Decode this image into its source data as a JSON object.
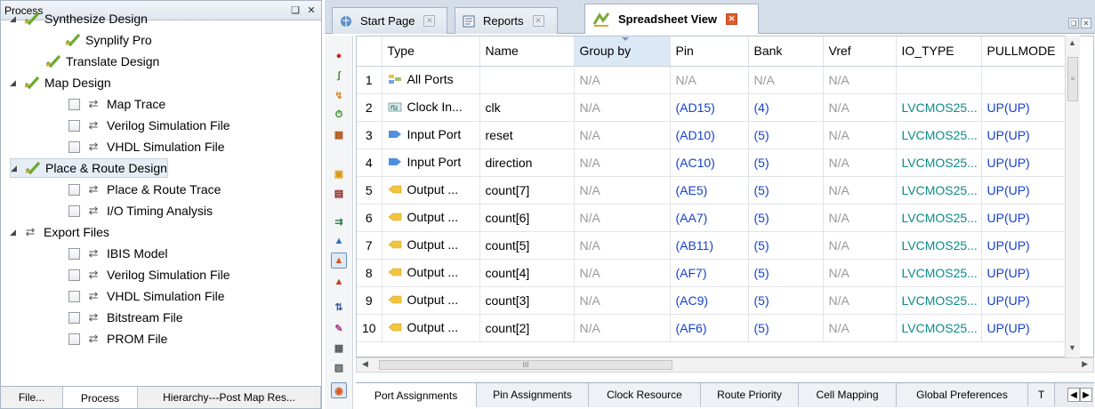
{
  "left_panel": {
    "title": "Process",
    "tree": [
      {
        "label": "Synthesize Design",
        "kind": "expanded-ok"
      },
      {
        "label": "Synplify Pro",
        "kind": "ok-child"
      },
      {
        "label": "Translate Design",
        "kind": "ok"
      },
      {
        "label": "Map Design",
        "kind": "expanded-ok"
      },
      {
        "label": "Map Trace",
        "kind": "check"
      },
      {
        "label": "Verilog Simulation File",
        "kind": "check"
      },
      {
        "label": "VHDL Simulation File",
        "kind": "check"
      },
      {
        "label": "Place & Route Design",
        "kind": "expanded-ok-selected"
      },
      {
        "label": "Place & Route Trace",
        "kind": "check"
      },
      {
        "label": "I/O Timing Analysis",
        "kind": "check"
      },
      {
        "label": "Export Files",
        "kind": "expanded-cycle"
      },
      {
        "label": "IBIS Model",
        "kind": "check"
      },
      {
        "label": "Verilog Simulation File",
        "kind": "check"
      },
      {
        "label": "VHDL Simulation File",
        "kind": "check"
      },
      {
        "label": "Bitstream File",
        "kind": "check"
      },
      {
        "label": "PROM File",
        "kind": "check"
      }
    ],
    "tabs": [
      "File...",
      "Process",
      "Hierarchy---Post Map Res..."
    ],
    "active_tab": "Process"
  },
  "doc_tabs": [
    {
      "label": "Start Page"
    },
    {
      "label": "Reports"
    },
    {
      "label": "Spreadsheet View",
      "active": true
    }
  ],
  "grid": {
    "columns": [
      "Type",
      "Name",
      "Group by",
      "Pin",
      "Bank",
      "Vref",
      "IO_TYPE",
      "PULLMODE"
    ],
    "rows": [
      {
        "n": "1",
        "type": "All Ports",
        "icon": "all",
        "name": "",
        "group": "N/A",
        "pin": "N/A",
        "bank": "N/A",
        "vref": "N/A",
        "io": "",
        "pull": ""
      },
      {
        "n": "2",
        "type": "Clock In...",
        "icon": "clock",
        "name": "clk",
        "group": "N/A",
        "pin": "(AD15)",
        "bank": "(4)",
        "vref": "N/A",
        "io": "LVCMOS25...",
        "pull": "UP(UP)"
      },
      {
        "n": "3",
        "type": "Input Port",
        "icon": "in",
        "name": "reset",
        "group": "N/A",
        "pin": "(AD10)",
        "bank": "(5)",
        "vref": "N/A",
        "io": "LVCMOS25...",
        "pull": "UP(UP)"
      },
      {
        "n": "4",
        "type": "Input Port",
        "icon": "in",
        "name": "direction",
        "group": "N/A",
        "pin": "(AC10)",
        "bank": "(5)",
        "vref": "N/A",
        "io": "LVCMOS25...",
        "pull": "UP(UP)"
      },
      {
        "n": "5",
        "type": "Output ...",
        "icon": "out",
        "name": "count[7]",
        "group": "N/A",
        "pin": "(AE5)",
        "bank": "(5)",
        "vref": "N/A",
        "io": "LVCMOS25...",
        "pull": "UP(UP)"
      },
      {
        "n": "6",
        "type": "Output ...",
        "icon": "out",
        "name": "count[6]",
        "group": "N/A",
        "pin": "(AA7)",
        "bank": "(5)",
        "vref": "N/A",
        "io": "LVCMOS25...",
        "pull": "UP(UP)"
      },
      {
        "n": "7",
        "type": "Output ...",
        "icon": "out",
        "name": "count[5]",
        "group": "N/A",
        "pin": "(AB11)",
        "bank": "(5)",
        "vref": "N/A",
        "io": "LVCMOS25...",
        "pull": "UP(UP)"
      },
      {
        "n": "8",
        "type": "Output ...",
        "icon": "out",
        "name": "count[4]",
        "group": "N/A",
        "pin": "(AF7)",
        "bank": "(5)",
        "vref": "N/A",
        "io": "LVCMOS25...",
        "pull": "UP(UP)"
      },
      {
        "n": "9",
        "type": "Output ...",
        "icon": "out",
        "name": "count[3]",
        "group": "N/A",
        "pin": "(AC9)",
        "bank": "(5)",
        "vref": "N/A",
        "io": "LVCMOS25...",
        "pull": "UP(UP)"
      },
      {
        "n": "10",
        "type": "Output ...",
        "icon": "out",
        "name": "count[2]",
        "group": "N/A",
        "pin": "(AF6)",
        "bank": "(5)",
        "vref": "N/A",
        "io": "LVCMOS25...",
        "pull": "UP(UP)"
      }
    ]
  },
  "hscroll_thumb": "III",
  "bottom_tabs": [
    "Port Assignments",
    "Pin Assignments",
    "Clock Resource",
    "Route Priority",
    "Cell Mapping",
    "Global Preferences",
    "T"
  ],
  "colors": {
    "accent": "#e05a2c",
    "pin_blue": "#1540d0",
    "io_teal": "#0d8a8c",
    "na_gray": "#999999"
  }
}
